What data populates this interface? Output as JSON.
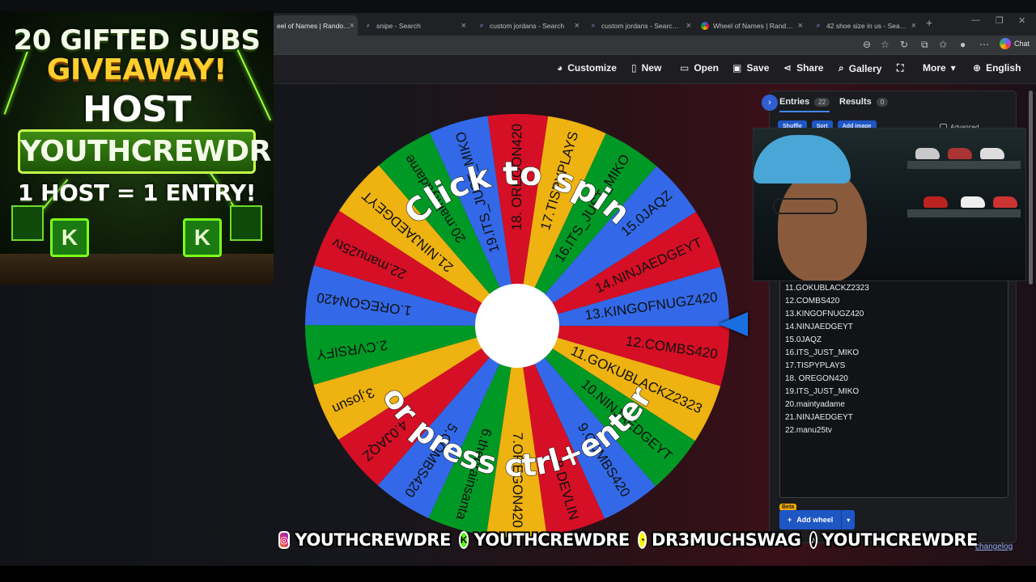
{
  "browser": {
    "tabs": [
      {
        "title": "eel of Names | Random n",
        "icon": "wheel-favicon",
        "active": true
      },
      {
        "title": "snipe - Search",
        "icon": "search-icon"
      },
      {
        "title": "custom jordans - Search",
        "icon": "search-icon"
      },
      {
        "title": "custom jordans - Search Ima",
        "icon": "search-icon"
      },
      {
        "title": "Wheel of Names | Random n",
        "icon": "wheel-favicon"
      },
      {
        "title": "42 shoe size in us - Search",
        "icon": "search-icon"
      }
    ],
    "chat_label": "Chat"
  },
  "toolbar": {
    "customize": "Customize",
    "new": "New",
    "open": "Open",
    "save": "Save",
    "share": "Share",
    "gallery": "Gallery",
    "more": "More",
    "language": "English"
  },
  "wheel": {
    "center_color": "#ffffff",
    "colors": [
      "#3369e8",
      "#d50f25",
      "#eeb211",
      "#009925"
    ],
    "overlay_top": "Click to spin",
    "overlay_bottom": "or press ctrl+enter",
    "segments": [
      "13.KINGOFNUGZ420",
      "12.COMBS420",
      "11.GOKUBLACKZ2323",
      "10.NINJAEDGEYT",
      "9.COMBS420",
      "8.DEVLIN",
      "7.OREGON420",
      "6.thebrainsanta",
      "5.COMBS420",
      "4.0JAQZ",
      "3.josun",
      "2.CVRSIFY",
      "1.OREGON420",
      "22.manu25tv",
      "21.NINJAEDGEYT",
      "20.maintyadame",
      "19.ITS_JUST_MIKO",
      "18. OREGON420",
      "17.TISPYPLAYS",
      "16.ITS_JUST_MIKO",
      "15.0JAQZ",
      "14.NINJAEDGEYT"
    ]
  },
  "panel": {
    "entries_tab": "Entries",
    "entries_count": "22",
    "results_tab": "Results",
    "results_count": "0",
    "shuffle": "Shuffle",
    "sort": "Sort",
    "add_image": "Add image",
    "advanced": "Advanced",
    "entries": [
      "11.GOKUBLACKZ2323",
      "12.COMBS420",
      "13.KINGOFNUGZ420",
      "14.NINJAEDGEYT",
      "15.0JAQZ",
      "16.ITS_JUST_MIKO",
      "17.TISPYPLAYS",
      "18. OREGON420",
      "19.ITS_JUST_MIKO",
      "20.maintyadame",
      "21.NINJAEDGEYT",
      "22.manu25tv"
    ],
    "beta_badge": "Beta",
    "add_wheel": "Add wheel",
    "changelog": "changelog"
  },
  "promo": {
    "line1": "20 GIFTED SUBS",
    "line2": "GIVEAWAY!",
    "line3": "HOST",
    "line4": "YOUTHCREWDRE",
    "line5": "1 HOST = 1 ENTRY!",
    "badge_letter": "K"
  },
  "social": {
    "instagram": "YOUTHCREWDRE",
    "kick": "YOUTHCREWDRE",
    "snapchat": "DR3MUCHSWAG",
    "tiktok": "YOUTHCREWDRE",
    "kick_letter": "K"
  }
}
